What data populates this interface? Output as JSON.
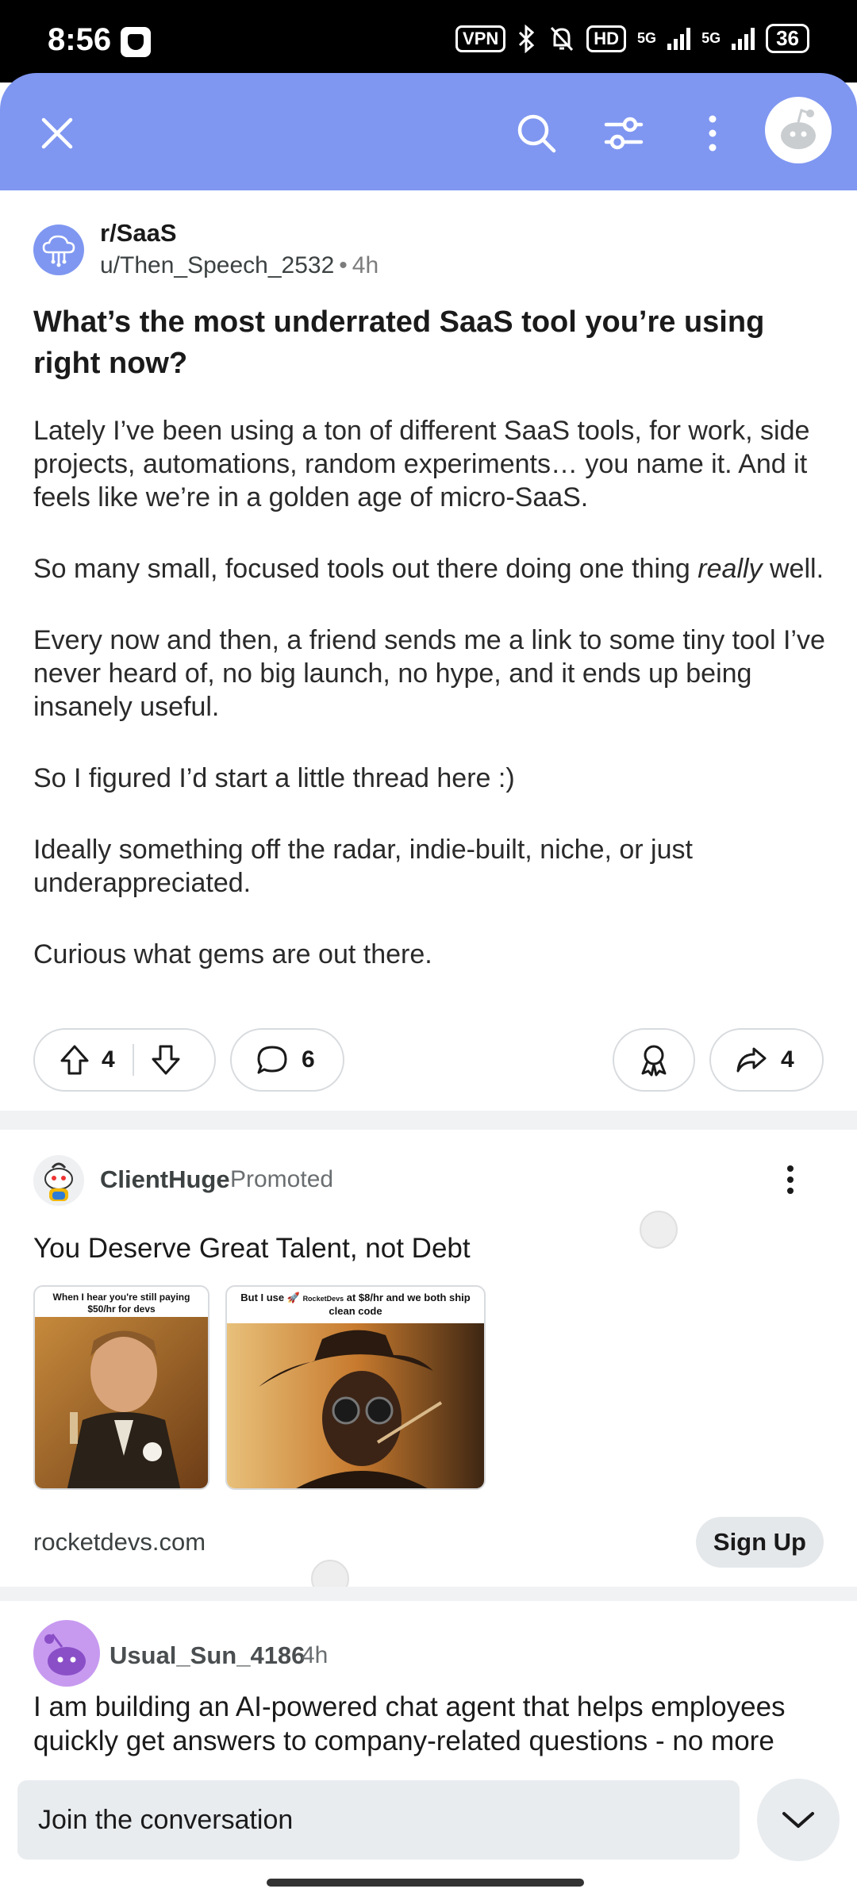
{
  "status_bar": {
    "time": "8:56",
    "vpn": "VPN",
    "hd": "HD",
    "net1": "5G",
    "net2": "5G",
    "battery": "36"
  },
  "toolbar": {
    "icons": [
      "close-icon",
      "search-icon",
      "filter-icon",
      "more-vert-icon",
      "avatar"
    ]
  },
  "post": {
    "subreddit": "r/SaaS",
    "author": "u/Then_Speech_2532",
    "separator": "•",
    "age": "4h",
    "title": "What’s the most underrated SaaS tool you’re using right now?",
    "p1": "Lately I’ve been using a ton of different SaaS tools, for work, side projects, automations, random experiments… you name it. And it feels like we’re in a golden age of micro-SaaS.",
    "p2_before": "So many small, focused tools out there doing one thing ",
    "p2_em": "really",
    "p2_after": " well.",
    "p3": "Every now and then, a friend sends me a link to some tiny tool I’ve never heard of, no big launch, no hype, and it ends up being insanely useful.",
    "p4": "So I figured I’d start a little thread here :)",
    "p5": "Ideally something off the radar, indie-built, niche, or just underappreciated.",
    "p6": "Curious what gems are out there.",
    "votes": "4",
    "comments": "6",
    "shares": "4"
  },
  "ad": {
    "advertiser": "ClientHuge",
    "promoted": "Promoted",
    "headline": "You Deserve Great Talent, not Debt",
    "img1_caption": "When I hear you're still paying $50/hr for devs",
    "img2_caption_a": "But I use",
    "img2_caption_brand": "RocketDevs",
    "img2_caption_b": "at $8/hr and we both ship clean code",
    "domain": "rocketdevs.com",
    "cta": "Sign Up"
  },
  "comment": {
    "author": "Usual_Sun_4186",
    "age": "4h",
    "text": "I am building an AI-powered chat agent that helps employees quickly get answers to company-related questions - no more digging through Confluence, SharePoint, or Google Drive."
  },
  "composer": {
    "placeholder": "Join the conversation"
  },
  "colors": {
    "header": "#7f97f1",
    "comment_avatar": "#c79af0"
  }
}
